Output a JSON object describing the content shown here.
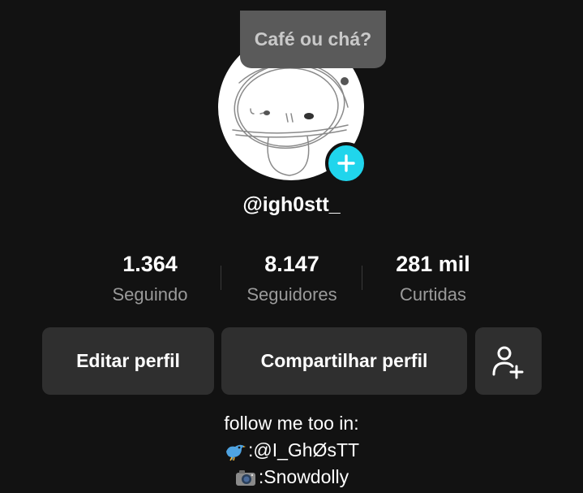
{
  "profile": {
    "note": "Café ou chá?",
    "username": "@igh0stt_",
    "add_icon": "plus-icon",
    "avatar_icon": "avatar-sketch"
  },
  "stats": [
    {
      "value": "1.364",
      "label": "Seguindo"
    },
    {
      "value": "8.147",
      "label": "Seguidores"
    },
    {
      "value": "281 mil",
      "label": "Curtidas"
    }
  ],
  "actions": {
    "edit_label": "Editar perfil",
    "share_label": "Compartilhar perfil",
    "add_friend_icon": "add-user-icon"
  },
  "bio": {
    "line1": "follow me too in:",
    "twitter_icon": "bird-emoji",
    "twitter": ":@I_GhØsTT",
    "camera_icon": "camera-emoji",
    "instagram": ":Snowdolly"
  },
  "colors": {
    "background": "#121212",
    "accent": "#20d5ec",
    "button": "#2f2f2f",
    "muted_text": "#9a9a9a"
  }
}
